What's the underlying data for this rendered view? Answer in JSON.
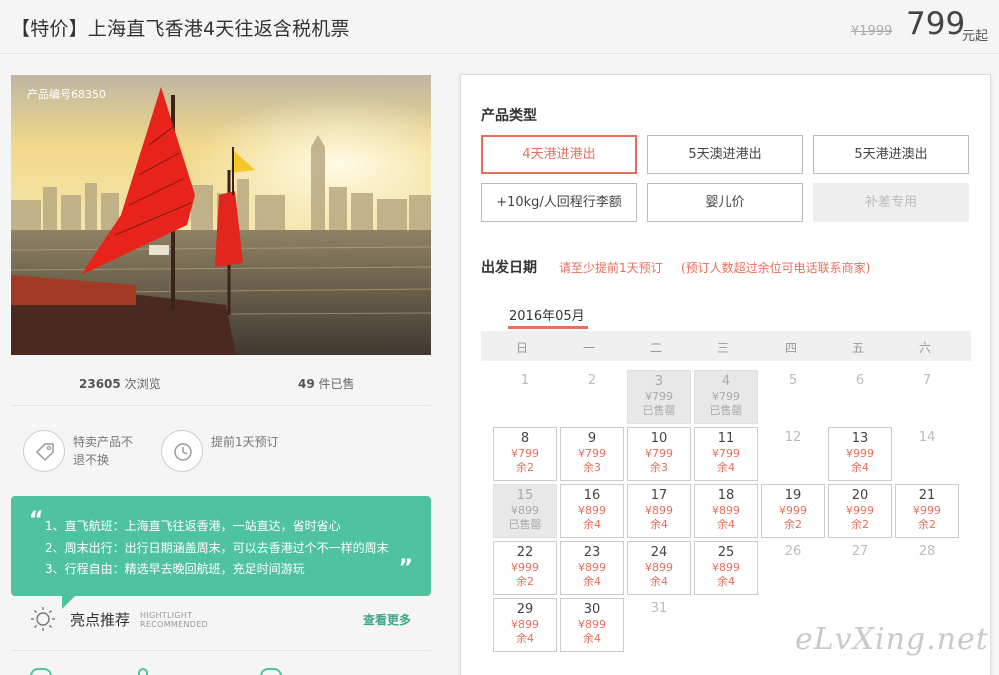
{
  "header": {
    "title": "【特价】上海直飞香港4天往返含税机票",
    "original_price": "¥1999",
    "price": "799",
    "price_unit": "元起"
  },
  "product": {
    "code_label": "产品编号68350",
    "views_count": "23605",
    "views_label": "次浏览",
    "sold_count": "49",
    "sold_label": "件已售"
  },
  "features": [
    {
      "icon": "tag-icon",
      "text": "特卖产品不退不换"
    },
    {
      "icon": "clock-icon",
      "text": "提前1天预订"
    }
  ],
  "highlights": {
    "lines": [
      "1、直飞航班：上海直飞往返香港，一站直达，省时省心",
      "2、周末出行：出行日期涵盖周末，可以去香港过个不一样的周末",
      "3、行程自由：精选早去晚回航班，充足时间游玩"
    ],
    "title": "亮点推荐",
    "subtitle_en_1": "HIGHTLIGHT",
    "subtitle_en_2": "RECOMMENDED",
    "more_label": "查看更多"
  },
  "booking": {
    "type_title": "产品类型",
    "options": [
      {
        "label": "4天港进港出",
        "state": "active"
      },
      {
        "label": "5天澳进港出",
        "state": "normal"
      },
      {
        "label": "5天港进澳出",
        "state": "normal"
      },
      {
        "label": "+10kg/人回程行李额",
        "state": "normal"
      },
      {
        "label": "婴儿价",
        "state": "normal"
      },
      {
        "label": "补差专用",
        "state": "disabled"
      }
    ],
    "date_title": "出发日期",
    "notice_advance": "请至少提前1天预订",
    "notice_contact": "(预订人数超过余位可电话联系商家)",
    "month_label": "2016年05月",
    "weekdays": [
      "日",
      "一",
      "二",
      "三",
      "四",
      "五",
      "六"
    ]
  },
  "calendar": [
    {
      "day": "1",
      "state": "none"
    },
    {
      "day": "2",
      "state": "none"
    },
    {
      "day": "3",
      "state": "soldout",
      "price": "¥799",
      "status": "已售罄"
    },
    {
      "day": "4",
      "state": "soldout",
      "price": "¥799",
      "status": "已售罄"
    },
    {
      "day": "5",
      "state": "none"
    },
    {
      "day": "6",
      "state": "none"
    },
    {
      "day": "7",
      "state": "none"
    },
    {
      "day": "8",
      "state": "avail",
      "price": "¥799",
      "status": "余2"
    },
    {
      "day": "9",
      "state": "avail",
      "price": "¥799",
      "status": "余3"
    },
    {
      "day": "10",
      "state": "avail",
      "price": "¥799",
      "status": "余3"
    },
    {
      "day": "11",
      "state": "avail",
      "price": "¥799",
      "status": "余4"
    },
    {
      "day": "12",
      "state": "none"
    },
    {
      "day": "13",
      "state": "avail",
      "price": "¥999",
      "status": "余4"
    },
    {
      "day": "14",
      "state": "none"
    },
    {
      "day": "15",
      "state": "soldout",
      "price": "¥899",
      "status": "已售罄"
    },
    {
      "day": "16",
      "state": "avail",
      "price": "¥899",
      "status": "余4"
    },
    {
      "day": "17",
      "state": "avail",
      "price": "¥899",
      "status": "余4"
    },
    {
      "day": "18",
      "state": "avail",
      "price": "¥899",
      "status": "余4"
    },
    {
      "day": "19",
      "state": "avail",
      "price": "¥999",
      "status": "余2"
    },
    {
      "day": "20",
      "state": "avail",
      "price": "¥999",
      "status": "余2"
    },
    {
      "day": "21",
      "state": "avail",
      "price": "¥999",
      "status": "余2"
    },
    {
      "day": "22",
      "state": "avail",
      "price": "¥999",
      "status": "余2"
    },
    {
      "day": "23",
      "state": "avail",
      "price": "¥899",
      "status": "余4"
    },
    {
      "day": "24",
      "state": "avail",
      "price": "¥899",
      "status": "余4"
    },
    {
      "day": "25",
      "state": "avail",
      "price": "¥899",
      "status": "余4"
    },
    {
      "day": "26",
      "state": "none"
    },
    {
      "day": "27",
      "state": "none"
    },
    {
      "day": "28",
      "state": "none"
    },
    {
      "day": "29",
      "state": "avail",
      "price": "¥899",
      "status": "余4"
    },
    {
      "day": "30",
      "state": "avail",
      "price": "¥899",
      "status": "余4"
    },
    {
      "day": "31",
      "state": "none"
    }
  ],
  "watermark": "eLvXing.net",
  "colors": {
    "accent": "#e4705c",
    "green": "#4fc29f"
  }
}
